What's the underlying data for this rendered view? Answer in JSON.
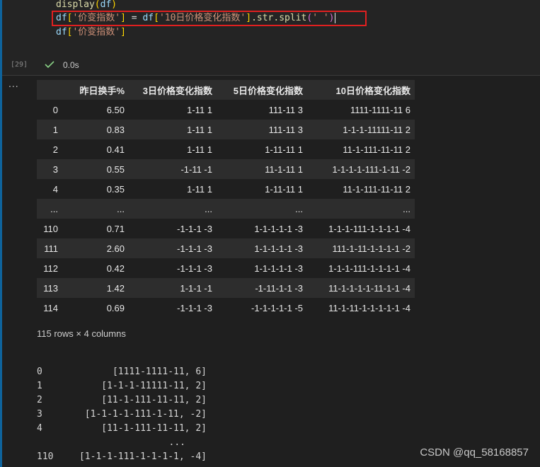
{
  "code": {
    "line1_fn": "display",
    "line1_arg": "df",
    "line2": {
      "lhs_var": "df",
      "lhs_key": "'价变指数'",
      "op": " = ",
      "rhs_var": "df",
      "rhs_key": "'10日价格变化指数'",
      "method": ".str.split",
      "arg": "' '"
    },
    "line3_var": "df",
    "line3_key": "'价变指数'"
  },
  "execution": {
    "count": "[29]",
    "time": "0.0s"
  },
  "output_menu": "...",
  "dataframe": {
    "columns": [
      "",
      "昨日换手%",
      "3日价格变化指数",
      "5日价格变化指数",
      "10日价格变化指数"
    ],
    "rows": [
      [
        "0",
        "6.50",
        "1-11 1",
        "111-11 3",
        "1111-1111-11 6"
      ],
      [
        "1",
        "0.83",
        "1-11 1",
        "111-11 3",
        "1-1-1-11111-11 2"
      ],
      [
        "2",
        "0.41",
        "1-11 1",
        "1-11-11 1",
        "11-1-111-11-11 2"
      ],
      [
        "3",
        "0.55",
        "-1-11 -1",
        "11-1-11 1",
        "1-1-1-1-111-1-11 -2"
      ],
      [
        "4",
        "0.35",
        "1-11 1",
        "1-11-11 1",
        "11-1-111-11-11 2"
      ],
      [
        "...",
        "...",
        "...",
        "...",
        "..."
      ],
      [
        "110",
        "0.71",
        "-1-1-1 -3",
        "1-1-1-1-1 -3",
        "1-1-1-111-1-1-1-1 -4"
      ],
      [
        "111",
        "2.60",
        "-1-1-1 -3",
        "1-1-1-1-1 -3",
        "111-1-11-1-1-1-1 -2"
      ],
      [
        "112",
        "0.42",
        "-1-1-1 -3",
        "1-1-1-1-1 -3",
        "1-1-1-111-1-1-1-1 -4"
      ],
      [
        "113",
        "1.42",
        "1-1-1 -1",
        "-1-11-1-1 -3",
        "11-1-1-1-1-11-1-1 -4"
      ],
      [
        "114",
        "0.69",
        "-1-1-1 -3",
        "-1-1-1-1-1 -5",
        "11-1-11-1-1-1-1-1 -4"
      ]
    ],
    "shape": "115 rows × 4 columns"
  },
  "series": [
    [
      "0",
      "[1111-1111-11, 6]"
    ],
    [
      "1",
      "[1-1-1-11111-11, 2]"
    ],
    [
      "2",
      "[11-1-111-11-11, 2]"
    ],
    [
      "3",
      "[1-1-1-1-111-1-11, -2]"
    ],
    [
      "4",
      "[11-1-111-11-11, 2]"
    ],
    [
      "",
      "..."
    ],
    [
      "110",
      "[1-1-1-111-1-1-1-1, -4]"
    ]
  ],
  "watermark": "CSDN @qq_58168857",
  "colors": {
    "editor_bg": "#1f1f1f",
    "highlight_border": "#e02020",
    "cell_indicator": "#0e639c",
    "success_check": "#89d185"
  }
}
